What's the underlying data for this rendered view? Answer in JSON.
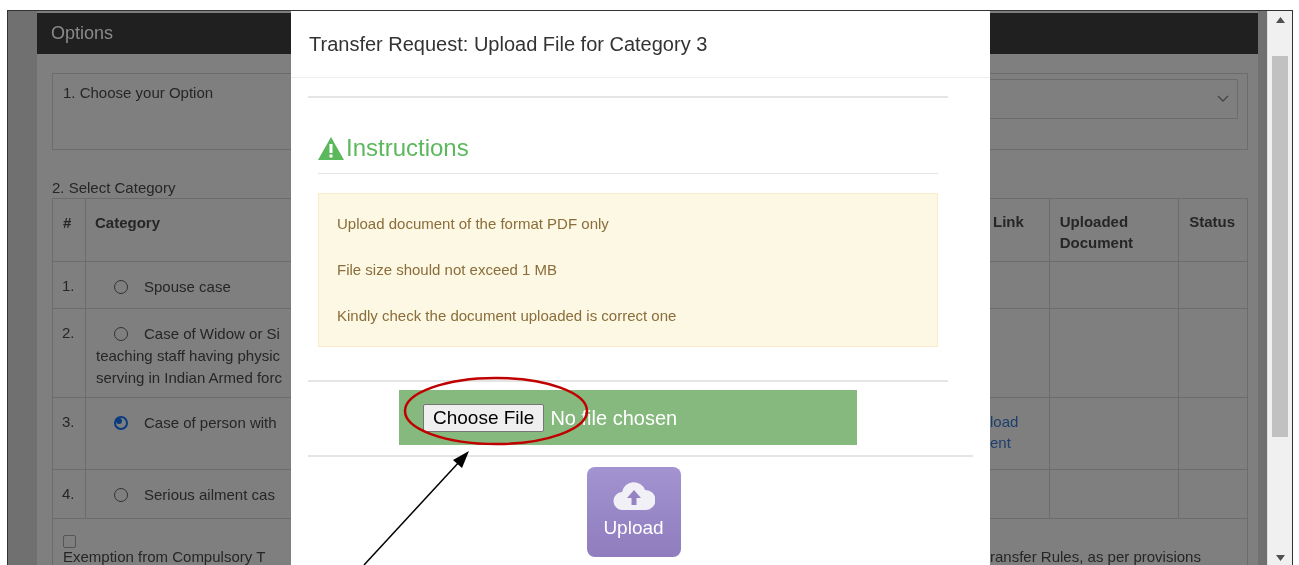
{
  "page": {
    "header": "Options",
    "option_label": "1. Choose your Option",
    "category_label": "2. Select Category",
    "table": {
      "columns": [
        "#",
        "Category",
        "Link",
        "Uploaded Document",
        "Status"
      ],
      "rows": [
        {
          "number": "1.",
          "category": [
            "Spouse case"
          ],
          "selected": false
        },
        {
          "number": "2.",
          "category": [
            "Case of Widow or Si",
            "teaching staff having physic",
            "serving in Indian Armed forc"
          ],
          "selected": false
        },
        {
          "number": "3.",
          "category": [
            "Case of person with"
          ],
          "selected": true,
          "link": [
            "load",
            "ent"
          ]
        },
        {
          "number": "4.",
          "category": [
            "Serious ailment cas"
          ],
          "selected": false
        }
      ]
    },
    "exemption": {
      "checked": false,
      "text_left": "Exemption from Compulsory T",
      "text_right": "ransfer Rules, as per provisions"
    }
  },
  "modal": {
    "title": "Transfer Request: Upload File for Category 3",
    "instructions_heading": "Instructions",
    "instructions": [
      "Upload document of the format PDF only",
      "File size should not exceed 1 MB",
      "Kindly check the document uploaded is correct one"
    ],
    "file_input": {
      "button": "Choose File",
      "status": "No file chosen"
    },
    "upload_button": "Upload"
  }
}
